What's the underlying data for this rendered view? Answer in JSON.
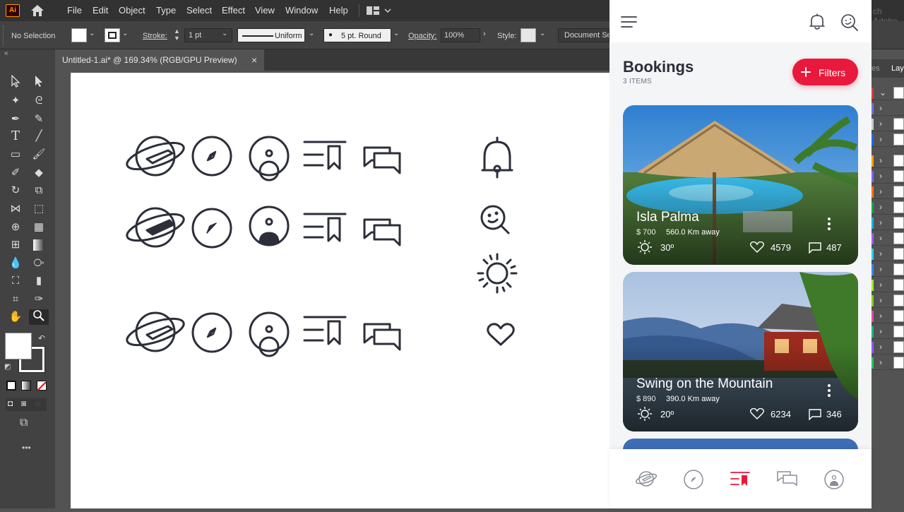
{
  "app": {
    "logo": "Ai",
    "menus": [
      "File",
      "Edit",
      "Object",
      "Type",
      "Select",
      "Effect",
      "View",
      "Window",
      "Help"
    ],
    "search_hint": "ch Adobe"
  },
  "control": {
    "selection": "No Selection",
    "stroke_label": "Stroke:",
    "stroke_value": "1 pt",
    "profile": "Uniform",
    "brush": "5 pt. Round",
    "opacity_label": "Opacity:",
    "opacity_value": "100%",
    "style_label": "Style:",
    "doc_setup": "Document Se"
  },
  "document": {
    "tab_title": "Untitled-1.ai* @ 169.34% (RGB/GPU Preview)",
    "close": "×"
  },
  "toolbar": {
    "more": "•••"
  },
  "panel": {
    "tabs": [
      "es",
      "Lay"
    ]
  },
  "phone": {
    "header": {
      "title": "Bookings",
      "subtitle": "3 ITEMS",
      "filter_label": "Filters"
    },
    "cards": [
      {
        "title": "Isla Palma",
        "price": "$ 700",
        "distance": "560.0 Km away",
        "temp": "30º",
        "likes": "4579",
        "comments": "487"
      },
      {
        "title": "Swing on the Mountain",
        "price": "$ 890",
        "distance": "390.0 Km away",
        "temp": "20º",
        "likes": "6234",
        "comments": "346"
      }
    ]
  },
  "colors": {
    "accent": "#e8193c",
    "icon_stroke": "#2c2f3a",
    "dark_ui": "#424242"
  }
}
